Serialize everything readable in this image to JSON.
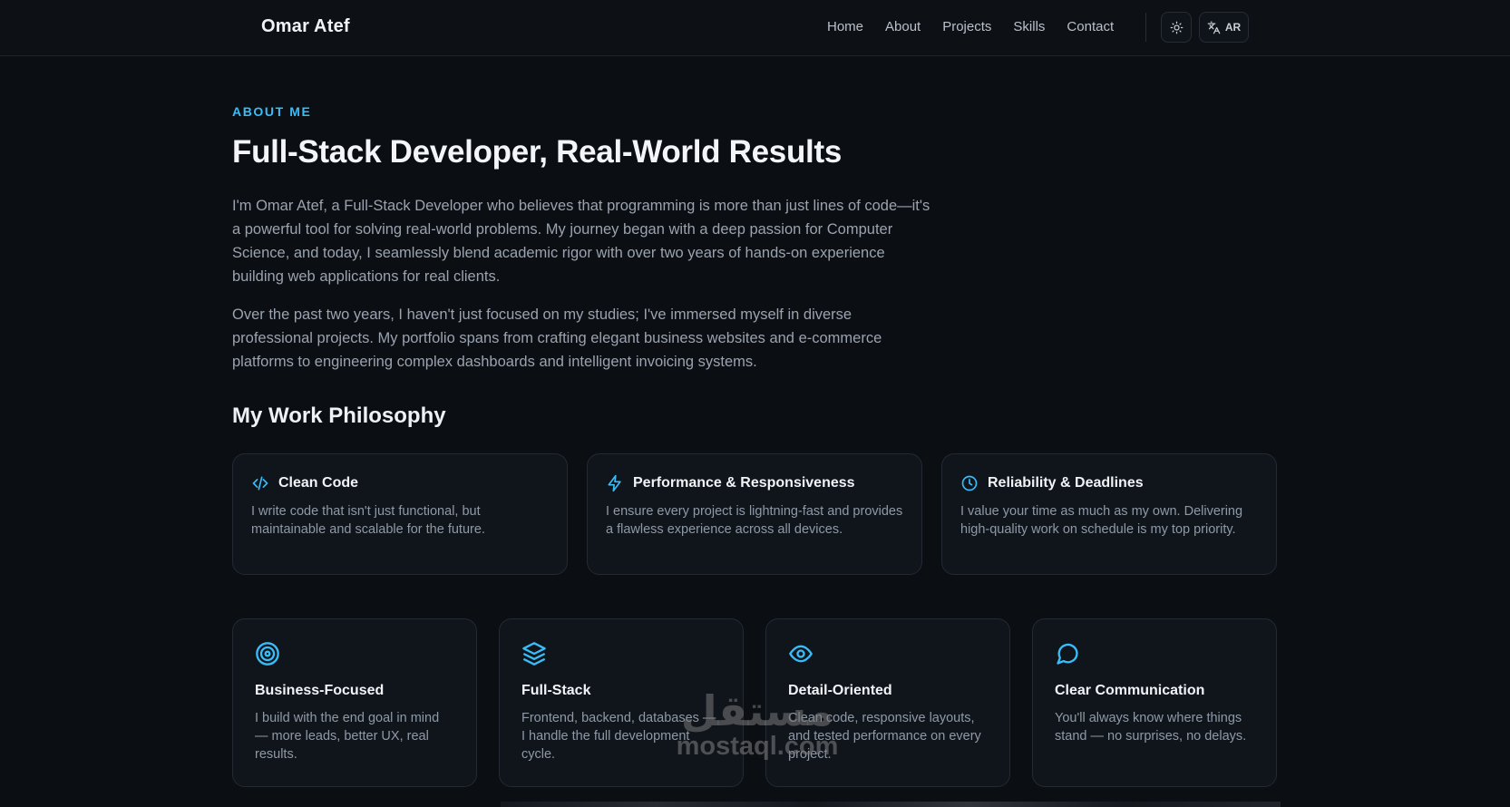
{
  "header": {
    "brand": "Omar Atef",
    "nav": [
      "Home",
      "About",
      "Projects",
      "Skills",
      "Contact"
    ],
    "theme_icon": "sun-icon",
    "lang_icon": "translate-icon",
    "lang_label": "AR"
  },
  "about": {
    "eyebrow": "ABOUT ME",
    "headline": "Full-Stack Developer, Real-World Results",
    "paragraphs": [
      "I'm Omar Atef, a Full-Stack Developer who believes that programming is more than just lines of code—it's a powerful tool for solving real-world problems. My journey began with a deep passion for Computer Science, and today, I seamlessly blend academic rigor with over two years of hands-on experience building web applications for real clients.",
      "Over the past two years, I haven't just focused on my studies; I've immersed myself in diverse professional projects. My portfolio spans from crafting elegant business websites and e-commerce platforms to engineering complex dashboards and intelligent invoicing systems."
    ]
  },
  "philosophy": {
    "title": "My Work Philosophy",
    "cards": [
      {
        "icon": "code-icon",
        "title": "Clean Code",
        "text": "I write code that isn't just functional, but maintainable and scalable for the future."
      },
      {
        "icon": "lightning-icon",
        "title": "Performance & Responsiveness",
        "text": "I ensure every project is lightning-fast and provides a flawless experience across all devices."
      },
      {
        "icon": "clock-icon",
        "title": "Reliability & Deadlines",
        "text": "I value your time as much as my own. Delivering high-quality work on schedule is my top priority."
      }
    ]
  },
  "features": [
    {
      "icon": "target-icon",
      "title": "Business-Focused",
      "text": "I build with the end goal in mind — more leads, better UX, real results."
    },
    {
      "icon": "layers-icon",
      "title": "Full-Stack",
      "text": "Frontend, backend, databases — I handle the full development cycle."
    },
    {
      "icon": "eye-icon",
      "title": "Detail-Oriented",
      "text": "Clean code, responsive layouts, and tested performance on every project."
    },
    {
      "icon": "chat-bubble-icon",
      "title": "Clear Communication",
      "text": "You'll always know where things stand — no surprises, no delays."
    }
  ],
  "watermark": {
    "arabic": "مستقل",
    "latin": "mostaql.com"
  },
  "colors": {
    "accent": "#38bdf8",
    "background": "#0b0e13",
    "card": "#10151c"
  }
}
